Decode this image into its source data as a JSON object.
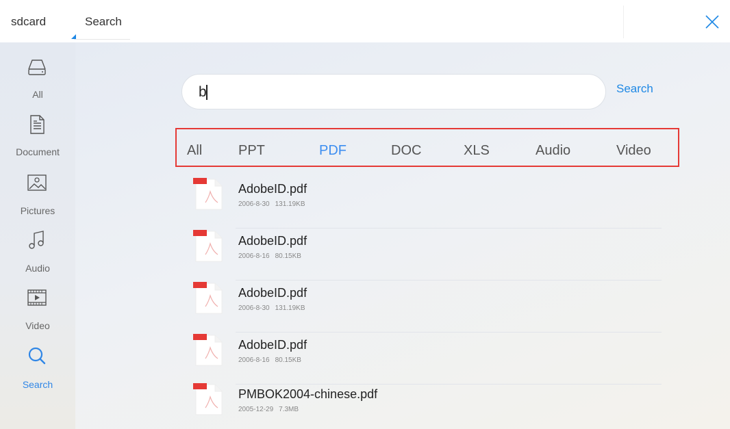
{
  "topbar": {
    "tabs": [
      {
        "label": "sdcard"
      },
      {
        "label": "Search"
      }
    ],
    "close_icon": "close-icon",
    "accent_color": "#1e88e5"
  },
  "sidebar": {
    "items": [
      {
        "label": "All",
        "icon": "drive-icon"
      },
      {
        "label": "Document",
        "icon": "document-icon"
      },
      {
        "label": "Pictures",
        "icon": "picture-icon"
      },
      {
        "label": "Audio",
        "icon": "music-note-icon"
      },
      {
        "label": "Video",
        "icon": "video-icon"
      },
      {
        "label": "Search",
        "icon": "search-icon",
        "active": true
      }
    ]
  },
  "search": {
    "value": "b",
    "button_label": "Search"
  },
  "filters": {
    "items": [
      "All",
      "PPT",
      "PDF",
      "DOC",
      "XLS",
      "Audio",
      "Video"
    ],
    "active": "PDF"
  },
  "files": [
    {
      "name": "AdobeID.pdf",
      "date": "2006-8-30",
      "size": "131.19KB",
      "badge": "PDF"
    },
    {
      "name": "AdobeID.pdf",
      "date": "2006-8-16",
      "size": "80.15KB",
      "badge": "PDF"
    },
    {
      "name": "AdobeID.pdf",
      "date": "2006-8-30",
      "size": "131.19KB",
      "badge": "PDF"
    },
    {
      "name": "AdobeID.pdf",
      "date": "2006-8-16",
      "size": "80.15KB",
      "badge": "PDF"
    },
    {
      "name": "PMBOK2004-chinese.pdf",
      "date": "2005-12-29",
      "size": "7.3MB",
      "badge": "PDF"
    }
  ],
  "colors": {
    "active_blue": "#3d8ef0",
    "highlight_border": "#e53935",
    "pdf_red": "#e53935"
  }
}
